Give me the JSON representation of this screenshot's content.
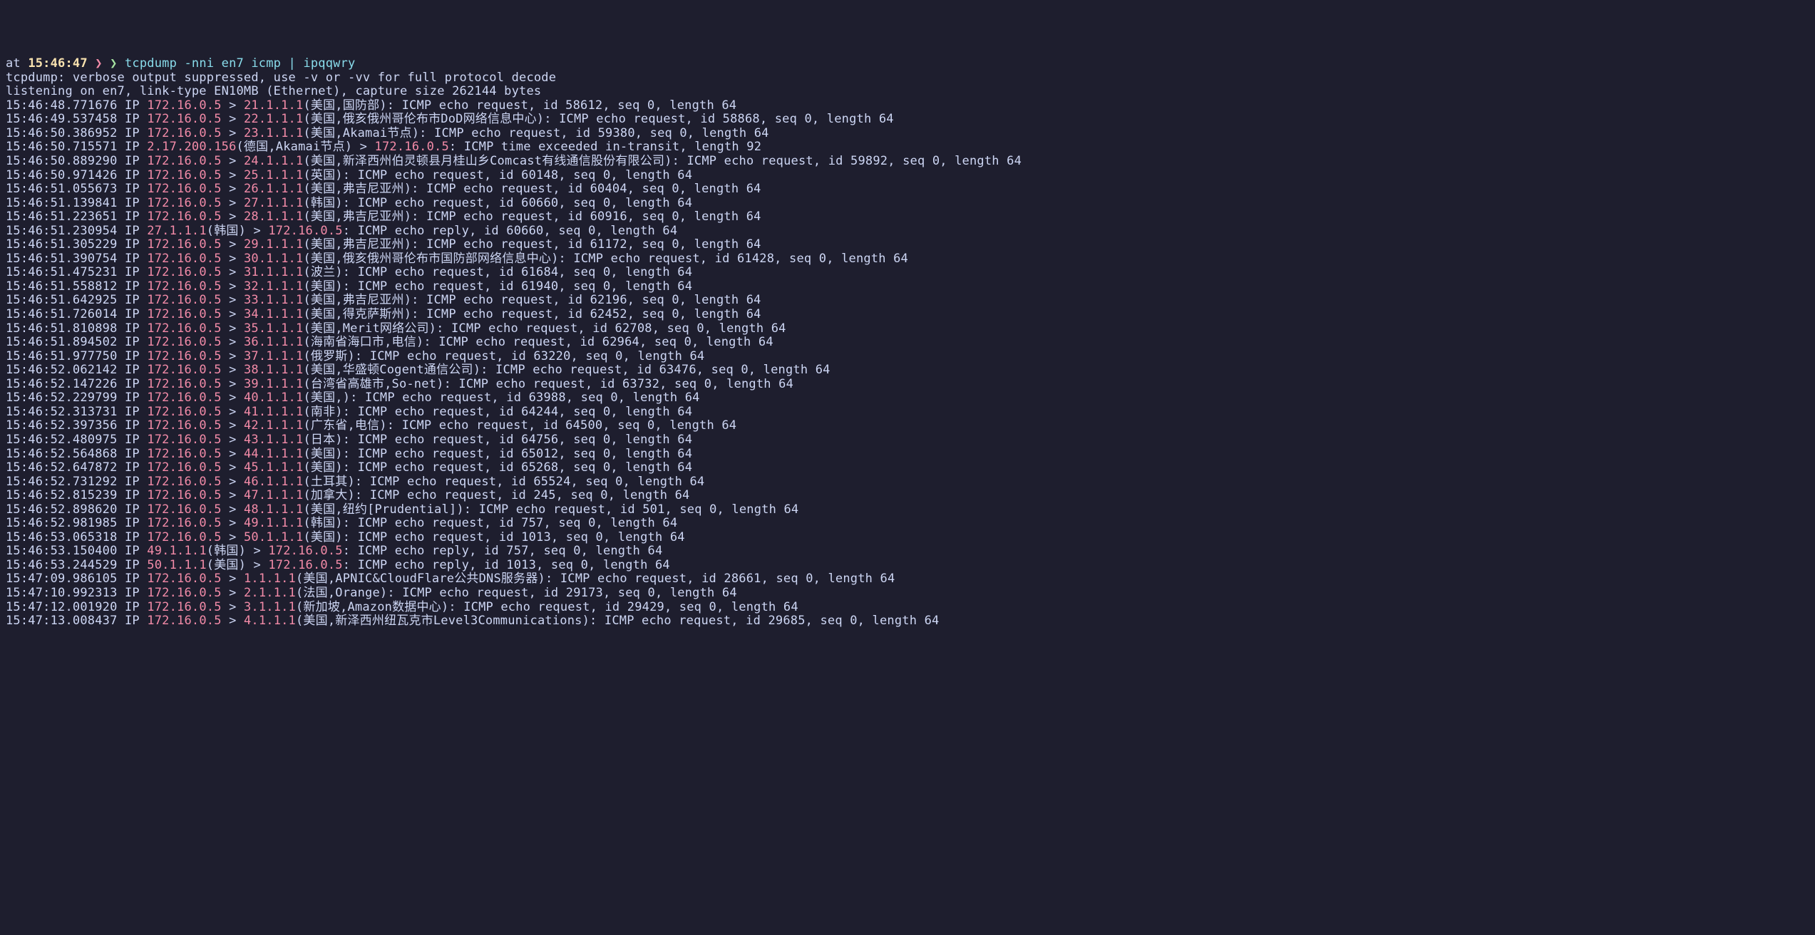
{
  "prompt": {
    "at": "at",
    "time": "15:46:47",
    "arrow1": "❯",
    "arrow2": "❯",
    "command": "tcpdump -nni en7 icmp | ipqqwry"
  },
  "header1": "tcpdump: verbose output suppressed, use -v or -vv for full protocol decode",
  "header2": "listening on en7, link-type EN10MB (Ethernet), capture size 262144 bytes",
  "packets": [
    {
      "ts": "15:46:48.771676",
      "src": "172.16.0.5",
      "dst": "21.1.1.1",
      "loc": "(美国,国防部)",
      "rest": ": ICMP echo request, id 58612, seq 0, length 64"
    },
    {
      "ts": "15:46:49.537458",
      "src": "172.16.0.5",
      "dst": "22.1.1.1",
      "loc": "(美国,俄亥俄州哥伦布市DoD网络信息中心)",
      "rest": ": ICMP echo request, id 58868, seq 0, length 64"
    },
    {
      "ts": "15:46:50.386952",
      "src": "172.16.0.5",
      "dst": "23.1.1.1",
      "loc": "(美国,Akamai节点)",
      "rest": ": ICMP echo request, id 59380, seq 0, length 64"
    },
    {
      "ts": "15:46:50.715571",
      "src": "2.17.200.156",
      "loc_pre": "(德国,Akamai节点)",
      "dst": "172.16.0.5",
      "rest": ": ICMP time exceeded in-transit, length 92"
    },
    {
      "ts": "15:46:50.889290",
      "src": "172.16.0.5",
      "dst": "24.1.1.1",
      "loc": "(美国,新泽西州伯灵顿县月桂山乡Comcast有线通信股份有限公司)",
      "rest": ": ICMP echo request, id 59892, seq 0, length 64"
    },
    {
      "ts": "15:46:50.971426",
      "src": "172.16.0.5",
      "dst": "25.1.1.1",
      "loc": "(英国)",
      "rest": ": ICMP echo request, id 60148, seq 0, length 64"
    },
    {
      "ts": "15:46:51.055673",
      "src": "172.16.0.5",
      "dst": "26.1.1.1",
      "loc": "(美国,弗吉尼亚州)",
      "rest": ": ICMP echo request, id 60404, seq 0, length 64"
    },
    {
      "ts": "15:46:51.139841",
      "src": "172.16.0.5",
      "dst": "27.1.1.1",
      "loc": "(韩国)",
      "rest": ": ICMP echo request, id 60660, seq 0, length 64"
    },
    {
      "ts": "15:46:51.223651",
      "src": "172.16.0.5",
      "dst": "28.1.1.1",
      "loc": "(美国,弗吉尼亚州)",
      "rest": ": ICMP echo request, id 60916, seq 0, length 64"
    },
    {
      "ts": "15:46:51.230954",
      "src": "27.1.1.1",
      "loc_pre": "(韩国)",
      "dst": "172.16.0.5",
      "rest": ": ICMP echo reply, id 60660, seq 0, length 64"
    },
    {
      "ts": "15:46:51.305229",
      "src": "172.16.0.5",
      "dst": "29.1.1.1",
      "loc": "(美国,弗吉尼亚州)",
      "rest": ": ICMP echo request, id 61172, seq 0, length 64"
    },
    {
      "ts": "15:46:51.390754",
      "src": "172.16.0.5",
      "dst": "30.1.1.1",
      "loc": "(美国,俄亥俄州哥伦布市国防部网络信息中心)",
      "rest": ": ICMP echo request, id 61428, seq 0, length 64"
    },
    {
      "ts": "15:46:51.475231",
      "src": "172.16.0.5",
      "dst": "31.1.1.1",
      "loc": "(波兰)",
      "rest": ": ICMP echo request, id 61684, seq 0, length 64"
    },
    {
      "ts": "15:46:51.558812",
      "src": "172.16.0.5",
      "dst": "32.1.1.1",
      "loc": "(美国)",
      "rest": ": ICMP echo request, id 61940, seq 0, length 64"
    },
    {
      "ts": "15:46:51.642925",
      "src": "172.16.0.5",
      "dst": "33.1.1.1",
      "loc": "(美国,弗吉尼亚州)",
      "rest": ": ICMP echo request, id 62196, seq 0, length 64"
    },
    {
      "ts": "15:46:51.726014",
      "src": "172.16.0.5",
      "dst": "34.1.1.1",
      "loc": "(美国,得克萨斯州)",
      "rest": ": ICMP echo request, id 62452, seq 0, length 64"
    },
    {
      "ts": "15:46:51.810898",
      "src": "172.16.0.5",
      "dst": "35.1.1.1",
      "loc": "(美国,Merit网络公司)",
      "rest": ": ICMP echo request, id 62708, seq 0, length 64"
    },
    {
      "ts": "15:46:51.894502",
      "src": "172.16.0.5",
      "dst": "36.1.1.1",
      "loc": "(海南省海口市,电信)",
      "rest": ": ICMP echo request, id 62964, seq 0, length 64"
    },
    {
      "ts": "15:46:51.977750",
      "src": "172.16.0.5",
      "dst": "37.1.1.1",
      "loc": "(俄罗斯)",
      "rest": ": ICMP echo request, id 63220, seq 0, length 64"
    },
    {
      "ts": "15:46:52.062142",
      "src": "172.16.0.5",
      "dst": "38.1.1.1",
      "loc": "(美国,华盛顿Cogent通信公司)",
      "rest": ": ICMP echo request, id 63476, seq 0, length 64"
    },
    {
      "ts": "15:46:52.147226",
      "src": "172.16.0.5",
      "dst": "39.1.1.1",
      "loc": "(台湾省高雄市,So-net)",
      "rest": ": ICMP echo request, id 63732, seq 0, length 64"
    },
    {
      "ts": "15:46:52.229799",
      "src": "172.16.0.5",
      "dst": "40.1.1.1",
      "loc": "(美国,)",
      "rest": ": ICMP echo request, id 63988, seq 0, length 64"
    },
    {
      "ts": "15:46:52.313731",
      "src": "172.16.0.5",
      "dst": "41.1.1.1",
      "loc": "(南非)",
      "rest": ": ICMP echo request, id 64244, seq 0, length 64"
    },
    {
      "ts": "15:46:52.397356",
      "src": "172.16.0.5",
      "dst": "42.1.1.1",
      "loc": "(广东省,电信)",
      "rest": ": ICMP echo request, id 64500, seq 0, length 64"
    },
    {
      "ts": "15:46:52.480975",
      "src": "172.16.0.5",
      "dst": "43.1.1.1",
      "loc": "(日本)",
      "rest": ": ICMP echo request, id 64756, seq 0, length 64"
    },
    {
      "ts": "15:46:52.564868",
      "src": "172.16.0.5",
      "dst": "44.1.1.1",
      "loc": "(美国)",
      "rest": ": ICMP echo request, id 65012, seq 0, length 64"
    },
    {
      "ts": "15:46:52.647872",
      "src": "172.16.0.5",
      "dst": "45.1.1.1",
      "loc": "(美国)",
      "rest": ": ICMP echo request, id 65268, seq 0, length 64"
    },
    {
      "ts": "15:46:52.731292",
      "src": "172.16.0.5",
      "dst": "46.1.1.1",
      "loc": "(土耳其)",
      "rest": ": ICMP echo request, id 65524, seq 0, length 64"
    },
    {
      "ts": "15:46:52.815239",
      "src": "172.16.0.5",
      "dst": "47.1.1.1",
      "loc": "(加拿大)",
      "rest": ": ICMP echo request, id 245, seq 0, length 64"
    },
    {
      "ts": "15:46:52.898620",
      "src": "172.16.0.5",
      "dst": "48.1.1.1",
      "loc": "(美国,纽约[Prudential])",
      "rest": ": ICMP echo request, id 501, seq 0, length 64"
    },
    {
      "ts": "15:46:52.981985",
      "src": "172.16.0.5",
      "dst": "49.1.1.1",
      "loc": "(韩国)",
      "rest": ": ICMP echo request, id 757, seq 0, length 64"
    },
    {
      "ts": "15:46:53.065318",
      "src": "172.16.0.5",
      "dst": "50.1.1.1",
      "loc": "(美国)",
      "rest": ": ICMP echo request, id 1013, seq 0, length 64"
    },
    {
      "ts": "15:46:53.150400",
      "src": "49.1.1.1",
      "loc_pre": "(韩国)",
      "dst": "172.16.0.5",
      "rest": ": ICMP echo reply, id 757, seq 0, length 64"
    },
    {
      "ts": "15:46:53.244529",
      "src": "50.1.1.1",
      "loc_pre": "(美国)",
      "dst": "172.16.0.5",
      "rest": ": ICMP echo reply, id 1013, seq 0, length 64"
    },
    {
      "ts": "15:47:09.986105",
      "src": "172.16.0.5",
      "dst": "1.1.1.1",
      "loc": "(美国,APNIC&CloudFlare公共DNS服务器)",
      "rest": ": ICMP echo request, id 28661, seq 0, length 64"
    },
    {
      "ts": "15:47:10.992313",
      "src": "172.16.0.5",
      "dst": "2.1.1.1",
      "loc": "(法国,Orange)",
      "rest": ": ICMP echo request, id 29173, seq 0, length 64"
    },
    {
      "ts": "15:47:12.001920",
      "src": "172.16.0.5",
      "dst": "3.1.1.1",
      "loc": "(新加坡,Amazon数据中心)",
      "rest": ": ICMP echo request, id 29429, seq 0, length 64"
    },
    {
      "ts": "15:47:13.008437",
      "src": "172.16.0.5",
      "dst": "4.1.1.1",
      "loc": "(美国,新泽西州纽瓦克市Level3Communications)",
      "rest": ": ICMP echo request, id 29685, seq 0, length 64"
    }
  ]
}
